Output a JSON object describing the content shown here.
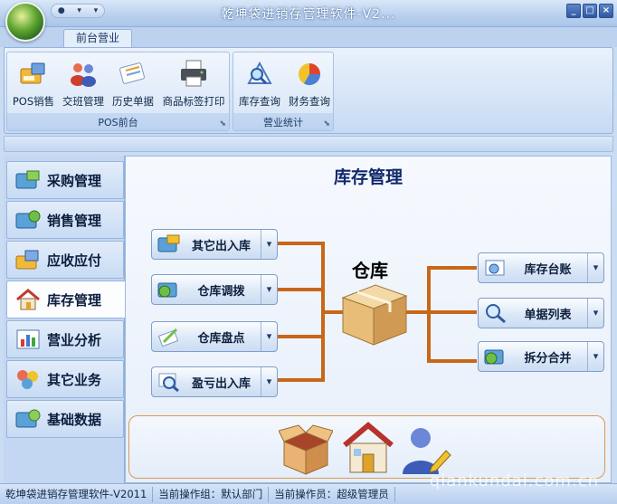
{
  "window": {
    "title": "乾坤袋进销存管理软件-V2...",
    "min_glyph": "_",
    "max_glyph": "□",
    "close_glyph": "×",
    "qat_glyphs": [
      "●",
      "▾",
      "▾"
    ]
  },
  "ribbon": {
    "active_tab": "前台营业",
    "groups": [
      {
        "title": "POS前台",
        "buttons": [
          {
            "label": "POS销售",
            "icon": "pos-icon"
          },
          {
            "label": "交班管理",
            "icon": "users-icon"
          },
          {
            "label": "历史单据",
            "icon": "history-icon"
          },
          {
            "label": "商品标签打印",
            "icon": "printer-icon"
          }
        ]
      },
      {
        "title": "营业统计",
        "buttons": [
          {
            "label": "库存查询",
            "icon": "stock-query-icon"
          },
          {
            "label": "财务查询",
            "icon": "pie-chart-icon"
          }
        ]
      }
    ]
  },
  "nav": {
    "items": [
      {
        "label": "采购管理",
        "icon": "purchase-icon"
      },
      {
        "label": "销售管理",
        "icon": "sales-icon"
      },
      {
        "label": "应收应付",
        "icon": "receivable-icon"
      },
      {
        "label": "库存管理",
        "icon": "house-icon",
        "active": true
      },
      {
        "label": "营业分析",
        "icon": "bar-chart-icon"
      },
      {
        "label": "其它业务",
        "icon": "misc-icon"
      },
      {
        "label": "基础数据",
        "icon": "database-icon"
      }
    ]
  },
  "main": {
    "title": "库存管理",
    "center_label": "仓库",
    "left_buttons": [
      "其它出入库",
      "仓库调拨",
      "仓库盘点",
      "盈亏出入库"
    ],
    "right_buttons": [
      "库存台账",
      "单据列表",
      "拆分合并"
    ],
    "arrow_glyph": "▾"
  },
  "status": {
    "app": "乾坤袋进销存管理软件-V2011",
    "group": "当前操作组：默认部门",
    "operator": "当前操作员：超级管理员"
  },
  "watermark": "qiankundai.com.cn",
  "colors": {
    "connector": "#c8661a",
    "accent": "#2e58a4"
  }
}
